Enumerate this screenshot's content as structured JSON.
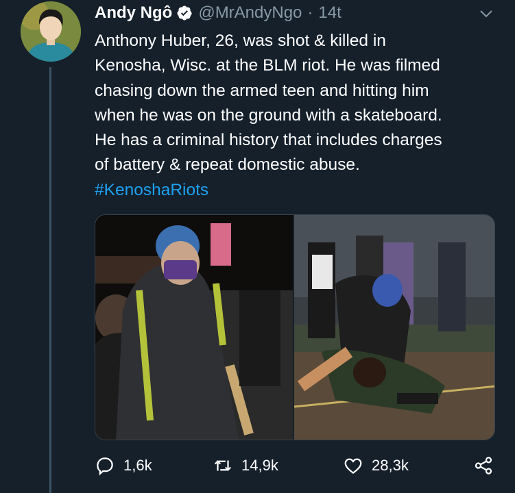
{
  "tweet": {
    "author_name": "Andy Ngô",
    "author_handle": "@MrAndyNgo",
    "separator": "·",
    "timestamp": "14t",
    "text_lines": [
      "Anthony Huber, 26, was shot & killed in",
      "Kenosha, Wisc. at the BLM riot. He was filmed",
      "chasing down the armed teen and hitting him",
      "when he was on the ground with a skateboard.",
      "He has a criminal history that includes charges",
      "of battery & repeat domestic abuse."
    ],
    "hashtag": "#KenoshaRiots"
  },
  "actions": {
    "replies": "1,6k",
    "retweets": "14,9k",
    "likes": "28,3k"
  },
  "icons": {
    "verified": "verified-badge-icon",
    "menu": "chevron-down-icon",
    "reply": "reply-icon",
    "retweet": "retweet-icon",
    "like": "heart-icon",
    "share": "share-icon"
  },
  "colors": {
    "background": "#15202b",
    "secondary_text": "#8899a6",
    "link": "#1da1f2",
    "verified": "#ffffff"
  }
}
